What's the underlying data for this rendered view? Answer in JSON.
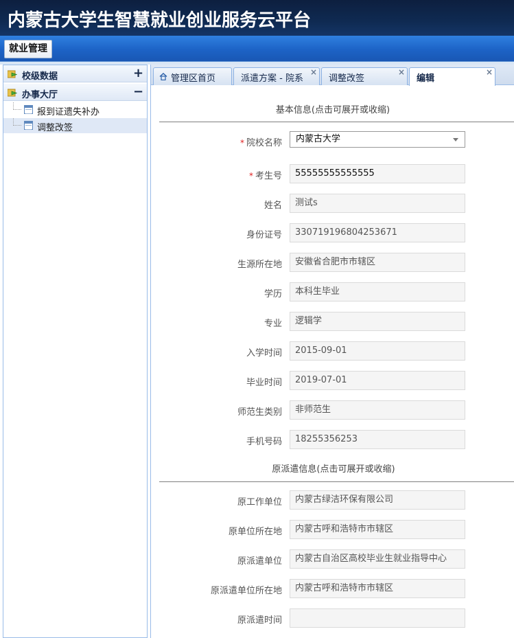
{
  "header": {
    "title": "内蒙古大学生智慧就业创业服务云平台"
  },
  "menubar": {
    "menu_label": "就业管理"
  },
  "sidebar": {
    "sections": [
      {
        "label": "校级数据",
        "toggle": "+"
      },
      {
        "label": "办事大厅",
        "toggle": "−"
      }
    ],
    "items": [
      {
        "label": "报到证遗失补办"
      },
      {
        "label": "调整改签"
      }
    ]
  },
  "tabs": [
    {
      "label": "管理区首页"
    },
    {
      "label": "派遣方案 - 院系"
    },
    {
      "label": "调整改签"
    },
    {
      "label": "编辑"
    }
  ],
  "basic": {
    "title": "基本信息(点击可展开或收缩)",
    "school": {
      "label": "院校名称",
      "value": "内蒙古大学"
    },
    "exam_no": {
      "label": "考生号",
      "value": "55555555555555"
    },
    "name": {
      "label": "姓名",
      "value": "测试s"
    },
    "id_no": {
      "label": "身份证号",
      "value": "330719196804253671"
    },
    "origin": {
      "label": "生源所在地",
      "value": "安徽省合肥市市辖区"
    },
    "degree": {
      "label": "学历",
      "value": "本科生毕业"
    },
    "major": {
      "label": "专业",
      "value": "逻辑学"
    },
    "enroll": {
      "label": "入学时间",
      "value": "2015-09-01"
    },
    "graduate": {
      "label": "毕业时间",
      "value": "2019-07-01"
    },
    "normal": {
      "label": "师范生类别",
      "value": "非师范生"
    },
    "phone": {
      "label": "手机号码",
      "value": "18255356253"
    }
  },
  "original": {
    "title": "原派遣信息(点击可展开或收缩)",
    "employer": {
      "label": "原工作单位",
      "value": "内蒙古绿洁环保有限公司"
    },
    "employer_loc": {
      "label": "原单位所在地",
      "value": "内蒙古呼和浩特市市辖区"
    },
    "dispatch_unit": {
      "label": "原派遣单位",
      "value": "内蒙古自治区高校毕业生就业指导中心"
    },
    "dispatch_loc": {
      "label": "原派遣单位所在地",
      "value": "内蒙古呼和浩特市市辖区"
    },
    "dispatch_time": {
      "label": "原派遣时间",
      "value": ""
    }
  },
  "colors": {
    "header": "#0f2a52",
    "menubar": "#1d63c6",
    "border": "#99bbe8",
    "required": "#e02020"
  },
  "icons": {
    "sidebar_section": "folder-arrow-icon",
    "tree_item": "grid-icon",
    "tab_home": "home-icon",
    "select": "chevron-down-icon",
    "tab_close": "close-icon"
  }
}
